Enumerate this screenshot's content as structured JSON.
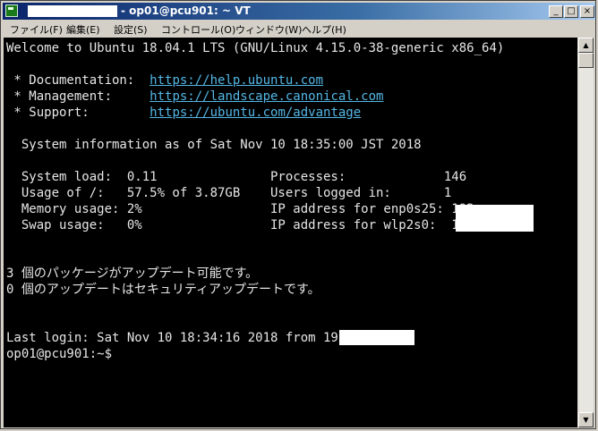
{
  "window": {
    "title": "- op01@pcu901: ~ VT",
    "buttons": {
      "minimize": "_",
      "maximize": "□",
      "close": "×"
    }
  },
  "menu": [
    "ファイル(F)",
    "編集(E)",
    "設定(S)",
    "コントロール(O)",
    "ウィンドウ(W)",
    "ヘルプ(H)"
  ],
  "terminal": {
    "welcome": "Welcome to Ubuntu 18.04.1 LTS (GNU/Linux 4.15.0-38-generic x86_64)",
    "docs_label": " * Documentation:  ",
    "docs_url": "https://help.ubuntu.com",
    "mgmt_label": " * Management:     ",
    "mgmt_url": "https://landscape.canonical.com",
    "support_label": " * Support:        ",
    "support_url": "https://ubuntu.com/advantage",
    "sysinfo": "  System information as of Sat Nov 10 18:35:00 JST 2018",
    "sysload": "  System load:  0.11               Processes:             146",
    "usage": "  Usage of /:   57.5% of 3.87GB    Users logged in:       1",
    "memory": "  Memory usage: 2%                 IP address for enp0s25: 192.",
    "swap": "  Swap usage:   0%                 IP address for wlp2s0:  192.",
    "pkg_updates": "3 個のパッケージがアップデート可能です。",
    "sec_updates": "0 個のアップデートはセキュリティアップデートです。",
    "last_login": "Last login: Sat Nov 10 18:34:16 2018 from 192.",
    "prompt": "op01@pcu901:~$"
  },
  "colors": {
    "background": "#000000",
    "text": "#e6e6e6",
    "link": "#54b7e6",
    "titlebar": "#0a246a"
  }
}
